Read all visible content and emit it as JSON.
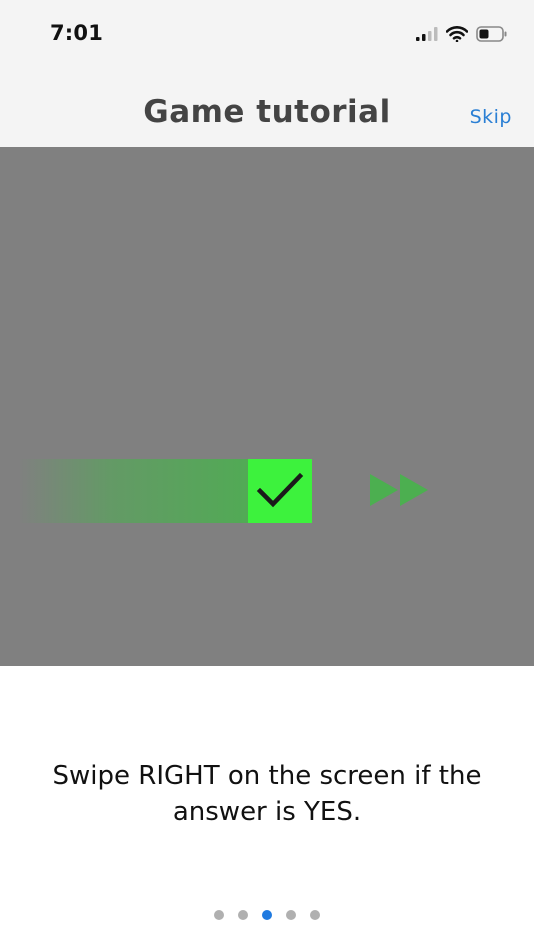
{
  "status_bar": {
    "time": "7:01",
    "icons": [
      "signal-icon",
      "wifi-icon",
      "battery-icon"
    ]
  },
  "nav": {
    "title": "Game tutorial",
    "skip_label": "Skip"
  },
  "demo": {
    "icons": [
      "checkmark-icon",
      "fast-forward-icon"
    ],
    "colors": {
      "background": "#808080",
      "check_box": "#3df23d",
      "arrows": "#4caf50"
    }
  },
  "instruction": {
    "text": "Swipe RIGHT on the screen if the answer is YES."
  },
  "pagination": {
    "total": 5,
    "active_index": 2,
    "active_color": "#1f7ae0"
  }
}
